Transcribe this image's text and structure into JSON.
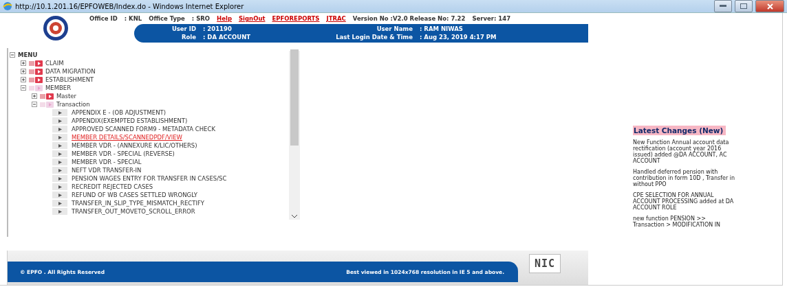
{
  "window": {
    "title": "http://10.1.201.16/EPFOWEB/Index.do - Windows Internet Explorer"
  },
  "header": {
    "info": [
      {
        "label": "Office ID",
        "value": ": KNL"
      },
      {
        "label": "Office Type",
        "value": ": SRO"
      }
    ],
    "links": [
      "Help",
      "SignOut",
      "EPFOREPORTS",
      "JTRAC"
    ],
    "version": "Version No :V2.0 Release No: 7.22",
    "server": "Server: 147",
    "user_rows": [
      [
        {
          "label": "User ID",
          "value": ": 201190"
        },
        {
          "label": "User Name",
          "value": ": RAM NIWAS"
        }
      ],
      [
        {
          "label": "Role",
          "value": ": DA ACCOUNT"
        },
        {
          "label": "Last Login Date & Time",
          "value": ": Aug 23, 2019 4:17 PM"
        }
      ]
    ]
  },
  "menu": {
    "label": "MENU",
    "kind": "root",
    "expanded": true,
    "children": [
      {
        "label": "CLAIM",
        "kind": "folder",
        "expanded": false
      },
      {
        "label": "DATA MIGRATION",
        "kind": "folder",
        "expanded": false
      },
      {
        "label": "ESTABLISHMENT",
        "kind": "folder",
        "expanded": false
      },
      {
        "label": "MEMBER",
        "kind": "folder",
        "expanded": true,
        "children": [
          {
            "label": "Master",
            "kind": "folder",
            "expanded": false
          },
          {
            "label": "Transaction",
            "kind": "folder",
            "expanded": true,
            "children": [
              {
                "label": "APPENDIX E - (OB ADJUSTMENT)",
                "kind": "leaf",
                "selected": false
              },
              {
                "label": "APPENDIX(EXEMPTED ESTABLISHMENT)",
                "kind": "leaf",
                "selected": false
              },
              {
                "label": "APPROVED SCANNED FORM9 - METADATA CHECK",
                "kind": "leaf",
                "selected": false
              },
              {
                "label": "MEMBER DETAILS/SCANNEDPDF/VIEW",
                "kind": "leaf",
                "selected": true
              },
              {
                "label": "MEMBER VDR - (ANNEXURE K/LIC/OTHERS)",
                "kind": "leaf",
                "selected": false
              },
              {
                "label": "MEMBER VDR - SPECIAL (REVERSE)",
                "kind": "leaf",
                "selected": false
              },
              {
                "label": "MEMBER VDR - SPECIAL",
                "kind": "leaf",
                "selected": false
              },
              {
                "label": "NEFT VDR TRANSFER-IN",
                "kind": "leaf",
                "selected": false
              },
              {
                "label": "PENSION WAGES ENTRY FOR TRANSFER IN CASES/SC",
                "kind": "leaf",
                "selected": false
              },
              {
                "label": "RECREDIT REJECTED CASES",
                "kind": "leaf",
                "selected": false
              },
              {
                "label": "REFUND OF WB CASES SETTLED WRONGLY",
                "kind": "leaf",
                "selected": false
              },
              {
                "label": "TRANSFER_IN_SLIP_TYPE_MISMATCH_RECTIFY",
                "kind": "leaf",
                "selected": false
              },
              {
                "label": "TRANSFER_OUT_MOVETO_SCROLL_ERROR",
                "kind": "leaf",
                "selected": false
              }
            ]
          }
        ]
      }
    ]
  },
  "latest_changes": {
    "title": "Latest Changes (New)",
    "items": [
      "New Function Annual account data rectification (account year 2016 issued) added @DA ACCOUNT, AC ACCOUNT",
      "Handled deferred pension with contribution in form 10D , Transfer in without PPO",
      "CPE SELECTION FOR ANNUAL ACCOUNT PROCESSING added at DA ACCOUNT ROLE",
      "new function PENSION >> Transaction > MODIFICATION IN"
    ]
  },
  "footer": {
    "copyright": "© EPFO . All Rights Reserved",
    "note": "Best viewed in 1024x768 resolution in IE 5 and above.",
    "logo_text": "NIC"
  }
}
